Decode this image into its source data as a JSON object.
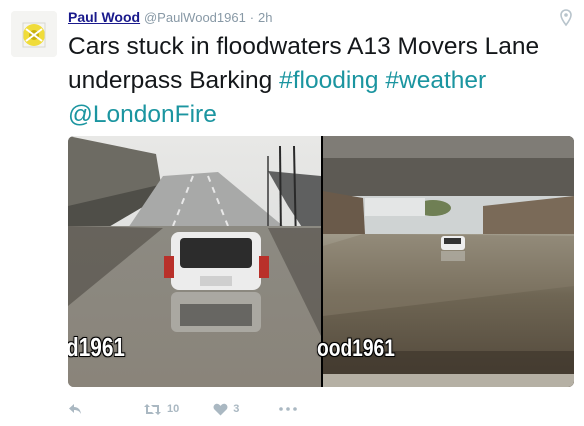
{
  "user": {
    "name": "Paul Wood",
    "handle": "@PaulWood1961",
    "separator": "·",
    "time": "2h"
  },
  "tweet": {
    "text_plain": "Cars stuck in floodwaters A13 Movers Lane underpass Barking ",
    "hashtag1": "#flooding",
    "hashtag2": "#weather",
    "mention": "@LondonFire"
  },
  "media": {
    "watermark_left": "d1961",
    "watermark_right": "ood1961"
  },
  "actions": {
    "retweet_count": "10",
    "like_count": "3"
  },
  "icons": [
    "location-pin-icon",
    "reply-icon",
    "retweet-icon",
    "heart-icon",
    "more-icon"
  ],
  "colors": {
    "link": "#1b95a0",
    "name": "#1a1a8c",
    "muted": "#8899a6",
    "action": "#aab8c2"
  }
}
